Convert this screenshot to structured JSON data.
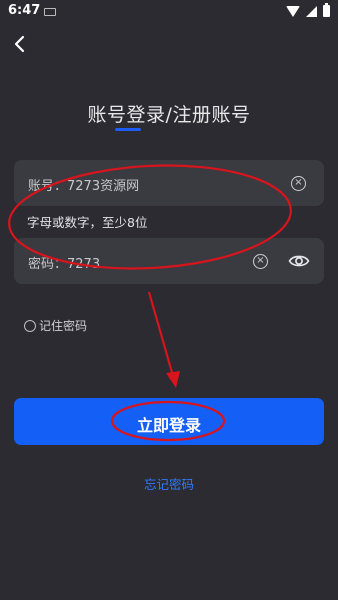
{
  "status_bar": {
    "time": "6:47"
  },
  "header": {
    "title": "账号登录/注册账号"
  },
  "form": {
    "account_label": "账号：7273资源网",
    "hint": "字母或数字，至少8位",
    "password_label": "密码：7273"
  },
  "options": {
    "remember_label": "记住密码"
  },
  "actions": {
    "login_label": "立即登录",
    "forgot_label": "忘记密码"
  },
  "colors": {
    "background": "#2b2b31",
    "field": "#3a3a41",
    "accent": "#1460f6",
    "link": "#2f7bff",
    "annotation": "#d8141c"
  },
  "icons": [
    "back-arrow-icon",
    "clear-icon",
    "eye-icon",
    "wifi-icon",
    "signal-icon",
    "battery-icon",
    "keyboard-icon"
  ]
}
